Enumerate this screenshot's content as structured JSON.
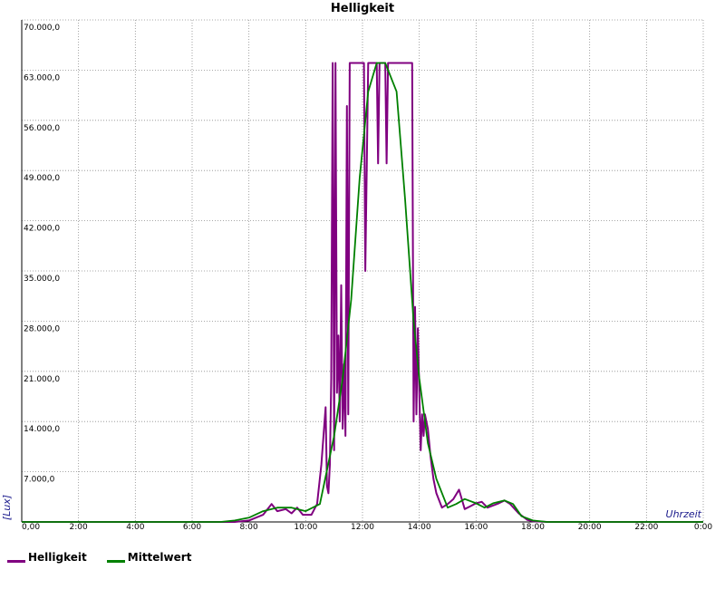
{
  "chart_data": {
    "type": "line",
    "title": "Helligkeit",
    "xlabel": "Uhrzeit",
    "ylabel": "[Lux]",
    "xlim": [
      0,
      24
    ],
    "ylim": [
      0,
      70000
    ],
    "grid": true,
    "legend_position": "bottom-left",
    "x_ticks": [
      "0,00",
      "2:00",
      "4:00",
      "6:00",
      "8:00",
      "10:00",
      "12:00",
      "14:00",
      "16:00",
      "18:00",
      "20:00",
      "22:00",
      "0:00"
    ],
    "y_ticks": [
      "7.000,0",
      "14.000,0",
      "21.000,0",
      "28.000,0",
      "35.000,0",
      "42.000,0",
      "49.000,0",
      "56.000,0",
      "63.000,0",
      "70.000,0"
    ],
    "series": [
      {
        "name": "Helligkeit",
        "color": "#800080",
        "x": [
          0,
          7.5,
          8.0,
          8.5,
          8.8,
          9.0,
          9.3,
          9.5,
          9.7,
          9.9,
          10.2,
          10.4,
          10.55,
          10.7,
          10.75,
          10.8,
          10.85,
          10.9,
          10.95,
          11.0,
          11.05,
          11.1,
          11.15,
          11.2,
          11.25,
          11.3,
          11.35,
          11.4,
          11.45,
          11.5,
          11.55,
          11.6,
          11.65,
          11.7,
          11.75,
          11.8,
          11.85,
          11.9,
          12.0,
          12.05,
          12.1,
          12.2,
          12.25,
          12.3,
          12.5,
          12.55,
          12.6,
          12.8,
          12.85,
          12.9,
          13.1,
          13.15,
          13.2,
          13.4,
          13.5,
          13.7,
          13.75,
          13.8,
          13.85,
          13.9,
          13.95,
          14.0,
          14.05,
          14.1,
          14.15,
          14.2,
          14.3,
          14.4,
          14.5,
          14.6,
          14.8,
          15.0,
          15.2,
          15.4,
          15.6,
          15.8,
          16.0,
          16.2,
          16.4,
          16.8,
          17.0,
          17.2,
          17.5,
          17.8,
          18.0,
          18.5,
          19.0,
          24.0
        ],
        "y": [
          0,
          0,
          200,
          1000,
          2500,
          1500,
          1800,
          1200,
          2000,
          1000,
          1000,
          2500,
          8000,
          16000,
          5000,
          4000,
          8000,
          20000,
          64000,
          10000,
          64000,
          18000,
          26000,
          14000,
          33000,
          13000,
          22000,
          12000,
          58000,
          15000,
          64000,
          64000,
          64000,
          64000,
          64000,
          64000,
          64000,
          64000,
          64000,
          64000,
          35000,
          64000,
          64000,
          64000,
          64000,
          50000,
          64000,
          64000,
          50000,
          64000,
          64000,
          64000,
          64000,
          64000,
          64000,
          64000,
          64000,
          14000,
          30000,
          15000,
          27000,
          18000,
          10000,
          15000,
          12000,
          15000,
          13000,
          9000,
          6000,
          4000,
          2000,
          2500,
          3200,
          4500,
          1800,
          2200,
          2600,
          2800,
          2000,
          2600,
          3000,
          2500,
          1200,
          300,
          100,
          0,
          0,
          0
        ]
      },
      {
        "name": "Mittelwert",
        "color": "#008000",
        "x": [
          0,
          7.0,
          7.5,
          8.0,
          8.5,
          9.0,
          9.5,
          10.0,
          10.5,
          11.0,
          11.3,
          11.6,
          11.9,
          12.2,
          12.5,
          12.8,
          13.2,
          13.5,
          13.8,
          14.0,
          14.3,
          14.6,
          15.0,
          15.3,
          15.6,
          16.0,
          16.3,
          16.6,
          17.0,
          17.3,
          17.6,
          18.0,
          18.5,
          19.0,
          24.0
        ],
        "y": [
          0,
          0,
          200,
          600,
          1500,
          2000,
          2000,
          1500,
          2500,
          12000,
          20000,
          31000,
          48000,
          60000,
          64000,
          64000,
          60000,
          45000,
          28000,
          20000,
          11000,
          6000,
          2000,
          2500,
          3200,
          2600,
          2000,
          2600,
          3000,
          2500,
          800,
          200,
          0,
          0,
          0
        ]
      }
    ]
  }
}
